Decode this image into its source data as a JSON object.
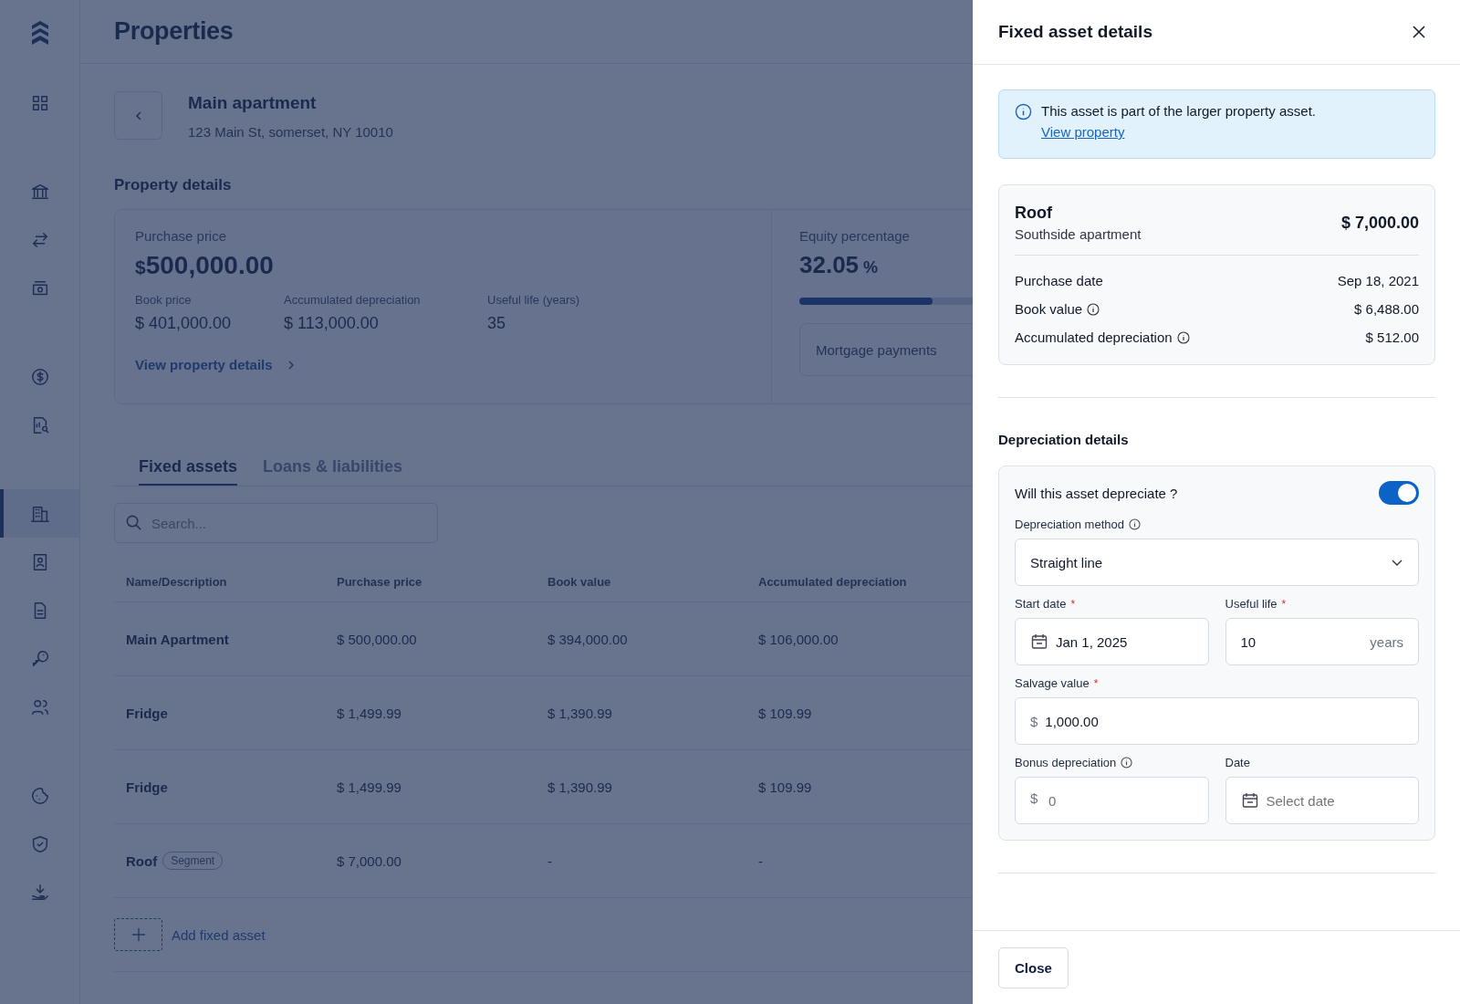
{
  "sidebar": {
    "groups": [
      {
        "items": [
          {
            "selected": false
          }
        ]
      },
      {
        "items": [
          {
            "selected": false
          },
          {
            "selected": false
          },
          {
            "selected": false
          }
        ]
      },
      {
        "items": [
          {
            "selected": false
          },
          {
            "selected": false
          }
        ]
      },
      {
        "items": [
          {
            "selected": true
          },
          {
            "selected": false
          },
          {
            "selected": false
          },
          {
            "selected": false
          },
          {
            "selected": false
          }
        ]
      },
      {
        "items": [
          {
            "selected": false
          },
          {
            "selected": false
          },
          {
            "selected": false
          }
        ]
      }
    ]
  },
  "header": {
    "title": "Properties"
  },
  "property": {
    "name": "Main apartment",
    "address": "123 Main St, somerset, NY 10010"
  },
  "property_details": {
    "title": "Property details",
    "purchase_price_label": "Purchase price",
    "currency": "$",
    "purchase_price": "500,000.00",
    "stats": [
      {
        "label": "Book price",
        "value": "$ 401,000.00"
      },
      {
        "label": "Accumulated depreciation",
        "value": "$ 113,000.00"
      },
      {
        "label": "Useful life (years)",
        "value": "35"
      }
    ],
    "link": "View property details",
    "equity": {
      "label": "Equity percentage",
      "value": "32.05",
      "unit": "%",
      "level": 0.3205
    },
    "mortgage": "Mortgage payments"
  },
  "tabs": [
    {
      "label": "Fixed assets",
      "selected": true
    },
    {
      "label": "Loans & liabilities",
      "selected": false
    }
  ],
  "search": {
    "placeholder": "Search..."
  },
  "table": {
    "columns": [
      "Name/Description",
      "Purchase price",
      "Book value",
      "Accumulated depreciation"
    ],
    "rows": [
      {
        "name": "Main Apartment",
        "purchase_price": "$ 500,000.00",
        "book_value": "$ 394,000.00",
        "accumulated_depreciation": "$ 106,000.00"
      },
      {
        "name": "Fridge",
        "purchase_price": "$ 1,499.99",
        "book_value": "$ 1,390.99",
        "accumulated_depreciation": "$ 109.99"
      },
      {
        "name": "Fridge",
        "purchase_price": "$ 1,499.99",
        "book_value": "$ 1,390.99",
        "accumulated_depreciation": "$ 109.99"
      },
      {
        "name": "Roof",
        "badge": "Segment",
        "purchase_price": "$ 7,000.00",
        "book_value": "-",
        "accumulated_depreciation": "-"
      }
    ]
  },
  "add_button": "Add fixed asset",
  "drawer": {
    "title": "Fixed asset details",
    "banner": {
      "text": "This asset is part of the larger property asset.",
      "link": "View property"
    },
    "asset": {
      "name": "Roof",
      "subtitle": "Southside apartment",
      "amount": "$ 7,000.00",
      "rows": [
        {
          "label": "Purchase date",
          "value": "Sep 18, 2021",
          "info": false
        },
        {
          "label": "Book value",
          "value": "$ 6,488.00",
          "info": true
        },
        {
          "label": "Accumulated depreciation",
          "value": "$ 512.00",
          "info": true
        }
      ]
    },
    "depreciation": {
      "title": "Depreciation details",
      "toggle": {
        "label": "Will this asset depreciate ?",
        "on": true
      },
      "method": {
        "label": "Depreciation method",
        "info": true,
        "value": "Straight line"
      },
      "start_date": {
        "label": "Start date",
        "required_mark": "*",
        "value": "Jan 1, 2025"
      },
      "useful_life": {
        "label": "Useful life",
        "required_mark": "*",
        "value": "10",
        "suffix": "years"
      },
      "salvage": {
        "label": "Salvage value",
        "required_mark": "*",
        "prefix": "$",
        "value": "1,000.00"
      },
      "bonus": {
        "label": "Bonus depreciation",
        "info": true,
        "prefix": "$",
        "placeholder": "0"
      },
      "date": {
        "label": "Date",
        "placeholder": "Select date"
      }
    },
    "close_button": "Close"
  }
}
